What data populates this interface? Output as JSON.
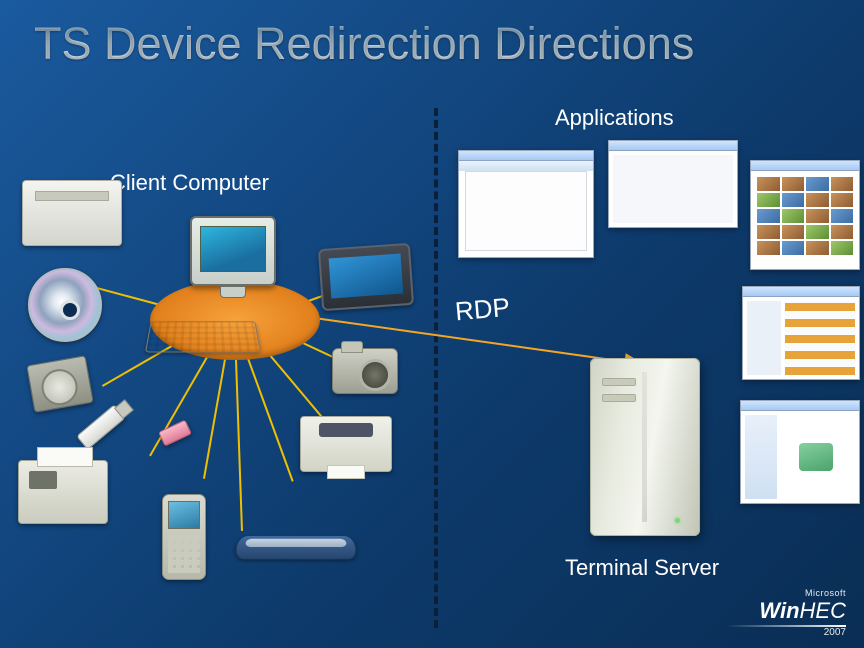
{
  "title": "TS Device Redirection Directions",
  "labels": {
    "client": "Client Computer",
    "applications": "Applications",
    "protocol": "RDP",
    "server": "Terminal Server"
  },
  "client_devices": [
    "laser-printer",
    "optical-disc",
    "hard-disk-drive",
    "usb-flash-drive",
    "usb-dongle",
    "fax-machine",
    "smartphone",
    "flatbed-scanner",
    "inkjet-printer",
    "digital-camera",
    "tablet-pda"
  ],
  "application_windows": [
    "word-processor",
    "file-explorer",
    "photo-gallery",
    "media-player",
    "system-properties"
  ],
  "footer": {
    "company": "Microsoft",
    "brand_prefix": "Win",
    "brand_suffix": "HEC",
    "year": "2007"
  }
}
